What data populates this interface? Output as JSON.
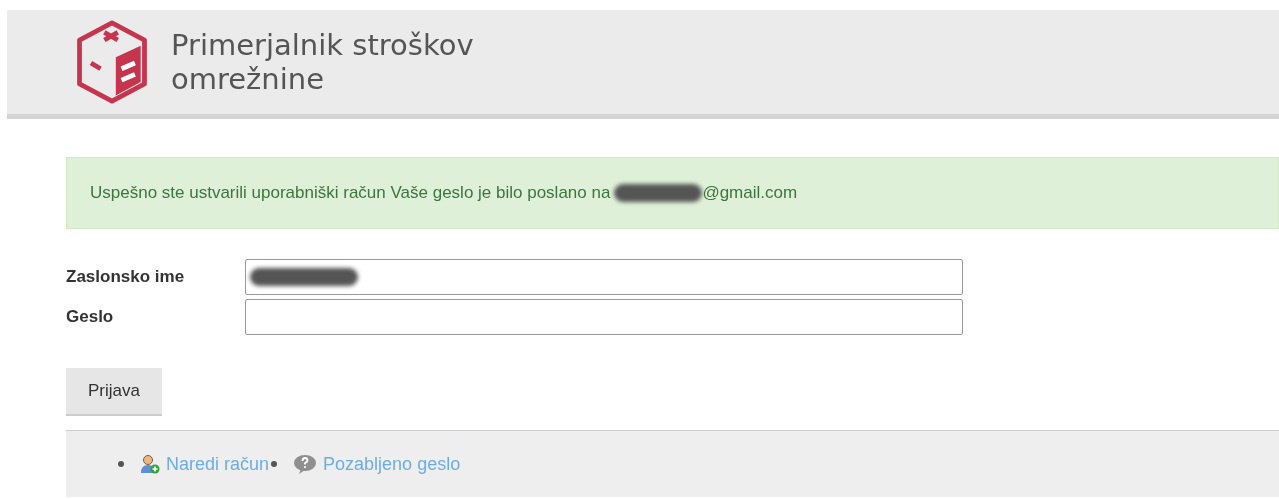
{
  "header": {
    "title_line_1": "Primerjalnik stroškov",
    "title_line_2": "omrežnine"
  },
  "alert": {
    "text_before": "Uspešno ste ustvarili uporabniški račun Vaše geslo je bilo poslano na",
    "text_after": "@gmail.com"
  },
  "form": {
    "fields": [
      {
        "label": "Zaslonsko ime",
        "redacted": true
      },
      {
        "label": "Geslo",
        "redacted": false
      }
    ],
    "submit": "Prijava"
  },
  "footer_links": [
    {
      "label": "Naredi račun",
      "kind": "signup"
    },
    {
      "label": "Pozabljeno geslo",
      "kind": "help"
    }
  ]
}
